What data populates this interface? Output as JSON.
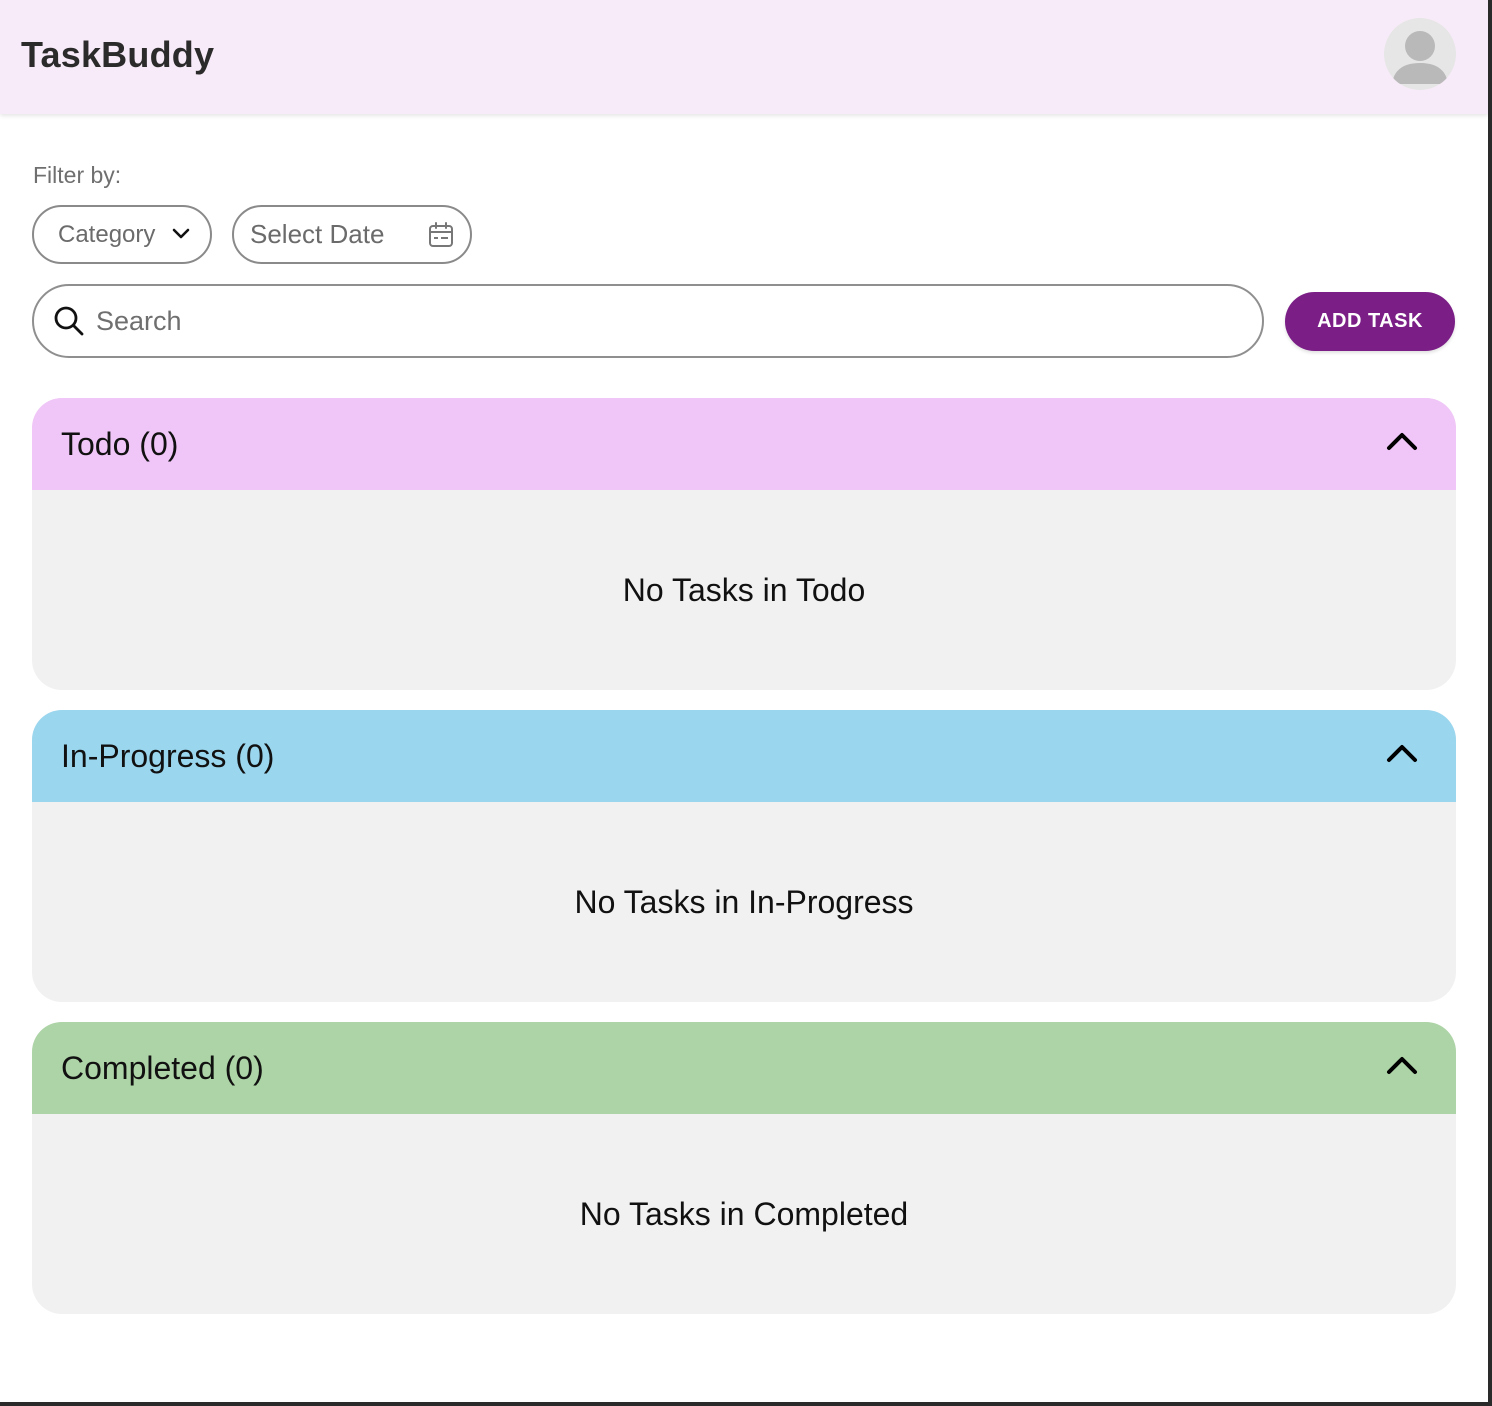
{
  "header": {
    "app_title": "TaskBuddy",
    "avatar_icon": "user-avatar-icon"
  },
  "filters": {
    "label": "Filter by:",
    "category_value": "Category",
    "category_icon": "chevron-down-icon",
    "date_value": "Select Date",
    "date_icon": "calendar-icon"
  },
  "search": {
    "placeholder": "Search",
    "icon": "search-icon"
  },
  "add_task_label": "ADD TASK",
  "sections": [
    {
      "title": "Todo (0)",
      "empty_text": "No Tasks in Todo",
      "color": "#f0c5f7",
      "icon": "chevron-up-icon"
    },
    {
      "title": "In-Progress (0)",
      "empty_text": "No Tasks in In-Progress",
      "color": "#9ad6ee",
      "icon": "chevron-up-icon"
    },
    {
      "title": "Completed (0)",
      "empty_text": "No Tasks in Completed",
      "color": "#add4a6",
      "icon": "chevron-up-icon"
    }
  ],
  "colors": {
    "header_bg": "#f8ebf9",
    "accent": "#7b1f87",
    "section_body_bg": "#f1f1f1"
  }
}
